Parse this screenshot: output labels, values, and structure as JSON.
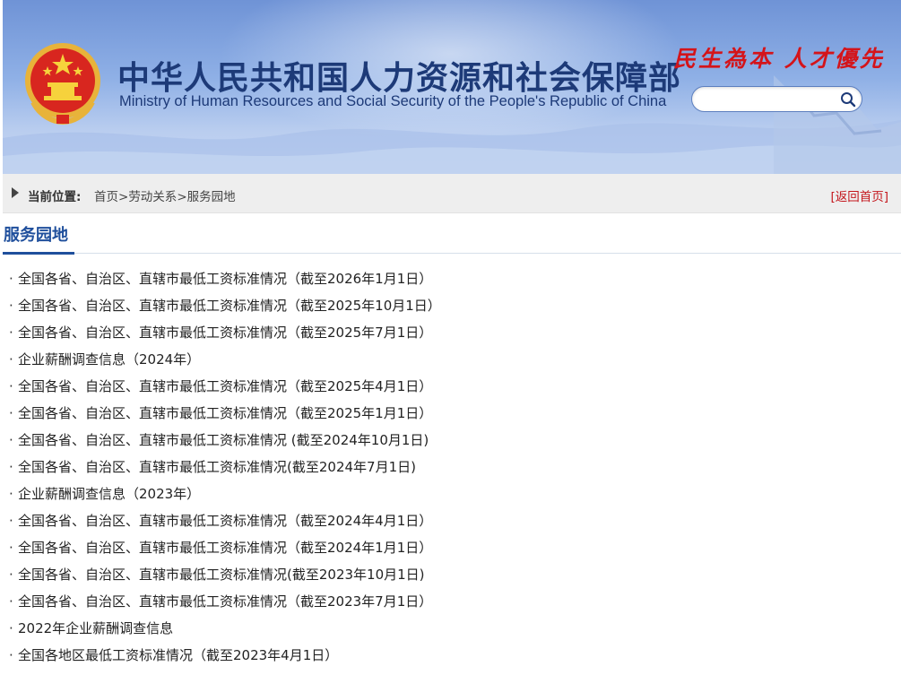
{
  "header": {
    "title_cn": "中华人民共和国人力资源和社会保障部",
    "title_en": "Ministry of Human Resources and Social Security of the People's Republic of China",
    "slogan": "民生為本 人才優先",
    "emblem_icon": "national-emblem-icon",
    "colors": {
      "title": "#1d3a78",
      "slogan": "#d4141a",
      "banner": "#8fb0e6"
    }
  },
  "search": {
    "value": "",
    "placeholder": "",
    "icon": "search-icon"
  },
  "breadcrumb": {
    "label": "当前位置:",
    "items": [
      "首页",
      "劳动关系",
      "服务园地"
    ],
    "separator": ">",
    "back_home": "[返回首页]",
    "arrow_icon": "triangle-right-icon"
  },
  "section": {
    "title": "服务园地",
    "accent_color": "#1f4f9c"
  },
  "news": {
    "bullet": "·",
    "items": [
      "全国各省、自治区、直辖市最低工资标准情况（截至2026年1月1日）",
      "全国各省、自治区、直辖市最低工资标准情况（截至2025年10月1日）",
      "全国各省、自治区、直辖市最低工资标准情况（截至2025年7月1日）",
      "企业薪酬调查信息（2024年）",
      "全国各省、自治区、直辖市最低工资标准情况（截至2025年4月1日）",
      "全国各省、自治区、直辖市最低工资标准情况（截至2025年1月1日）",
      "全国各省、自治区、直辖市最低工资标准情况 (截至2024年10月1日)",
      "全国各省、自治区、直辖市最低工资标准情况(截至2024年7月1日)",
      "企业薪酬调查信息（2023年）",
      "全国各省、自治区、直辖市最低工资标准情况（截至2024年4月1日）",
      "全国各省、自治区、直辖市最低工资标准情况（截至2024年1月1日）",
      "全国各省、自治区、直辖市最低工资标准情况(截至2023年10月1日)",
      "全国各省、自治区、直辖市最低工资标准情况（截至2023年7月1日）",
      "2022年企业薪酬调查信息",
      "全国各地区最低工资标准情况（截至2023年4月1日）"
    ]
  }
}
